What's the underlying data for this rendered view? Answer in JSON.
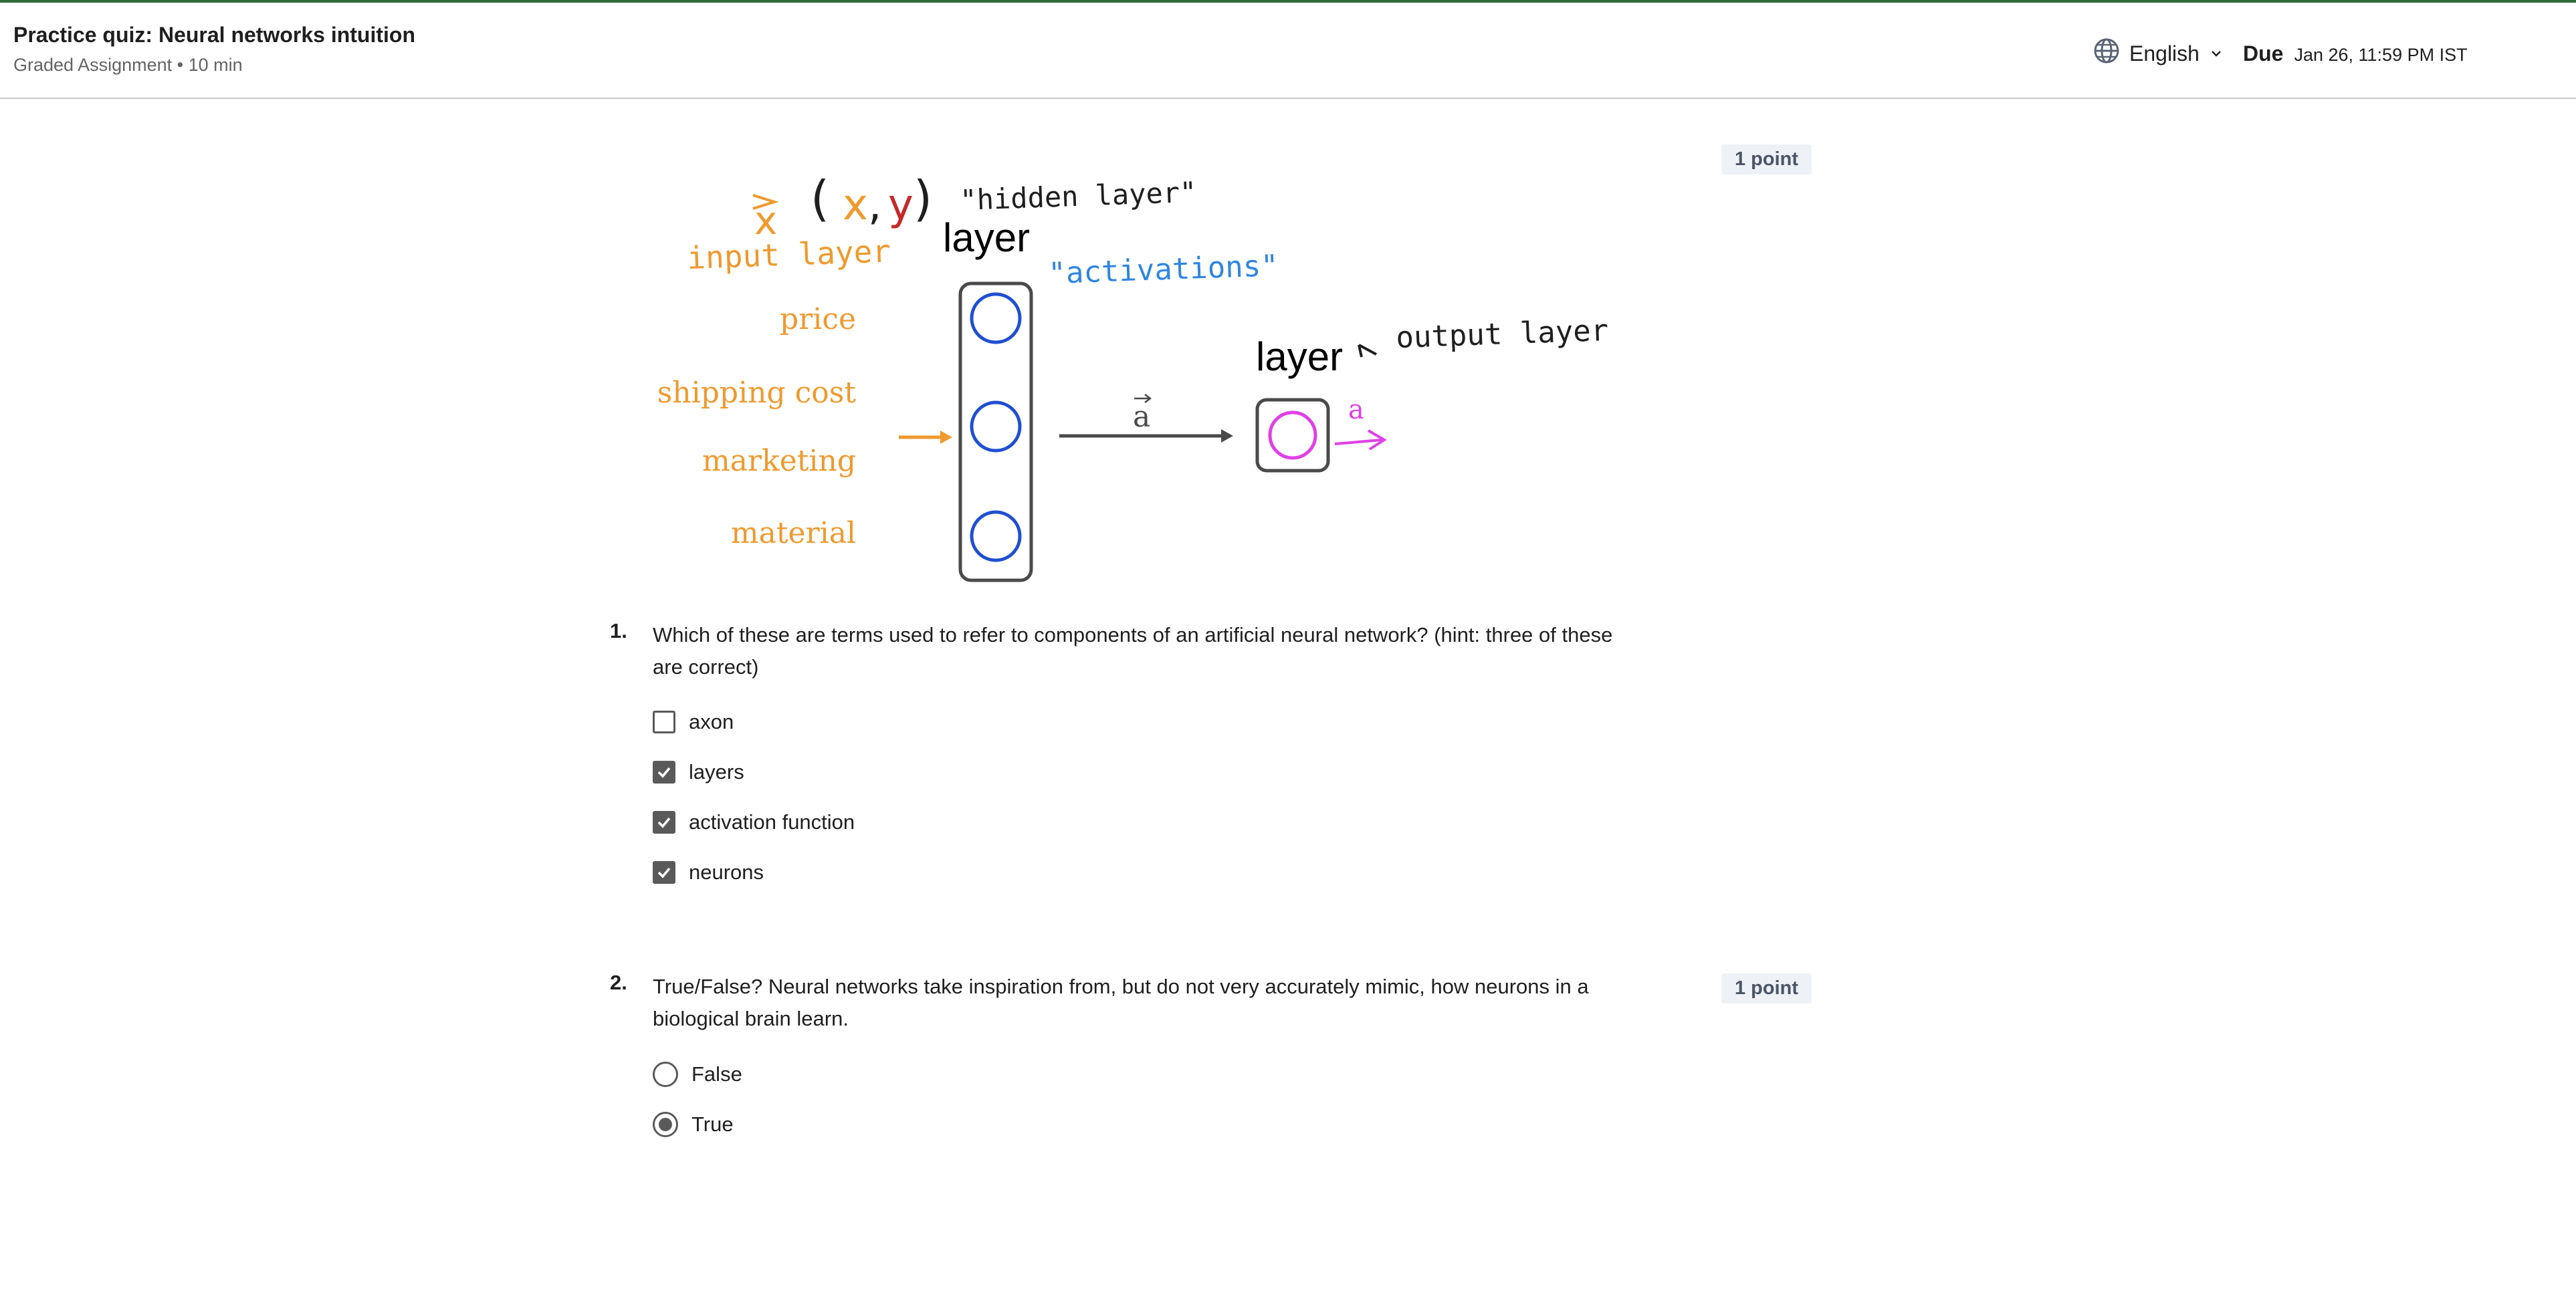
{
  "header": {
    "title": "Practice quiz: Neural networks intuition",
    "subtitle": "Graded Assignment • 10 min",
    "language": "English",
    "due_label": "Due",
    "due_date": "Jan 26, 11:59 PM IST"
  },
  "diagram": {
    "x_vector": "x",
    "pair_open": "(",
    "pair_x": "x",
    "pair_comma": ",",
    "pair_y": "y",
    "pair_close": ")",
    "hidden_layer_note": "\"hidden layer\"",
    "hidden_layer_label": "layer",
    "input_layer_note": "input layer",
    "activations_note": "\"activations\"",
    "inputs": [
      "price",
      "shipping cost",
      "marketing",
      "material"
    ],
    "output_layer_label": "layer",
    "output_layer_note": "output layer",
    "activation_vector": "a",
    "output_activation": "a"
  },
  "questions": [
    {
      "number": "1.",
      "points": "1 point",
      "text": "Which of these are terms used to refer to components of an artificial neural network? (hint: three of these are correct)",
      "options": [
        {
          "label": "axon",
          "checked": false
        },
        {
          "label": "layers",
          "checked": true
        },
        {
          "label": "activation function",
          "checked": true
        },
        {
          "label": "neurons",
          "checked": true
        }
      ]
    },
    {
      "number": "2.",
      "points": "1 point",
      "text": "True/False? Neural networks take inspiration from, but do not very accurately mimic, how neurons in a biological brain learn.",
      "options": [
        {
          "label": "False",
          "selected": false
        },
        {
          "label": "True",
          "selected": true
        }
      ]
    }
  ],
  "colors": {
    "accent_bar": "#2f6b3a",
    "input_orange": "#ef9a2e",
    "y_red": "#c62828",
    "hidden_neuron_blue": "#1f4fd1",
    "activations_blue": "#2f86e0",
    "output_magenta": "#e040e6",
    "control_gray": "#5a5a5a"
  }
}
